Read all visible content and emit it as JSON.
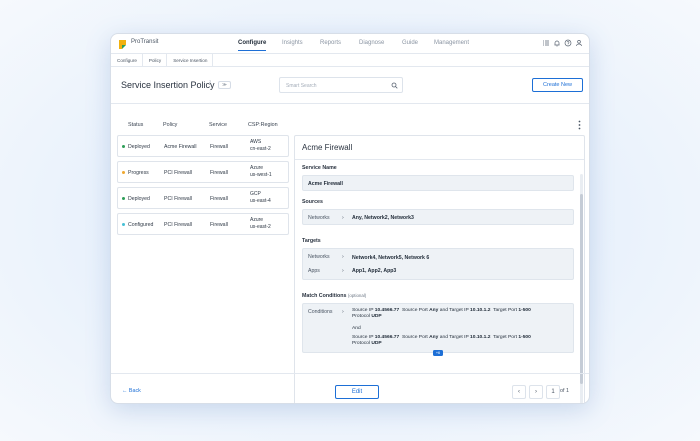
{
  "app": {
    "brand": "ProTransit"
  },
  "nav": {
    "tabs": [
      "Configure",
      "Insights",
      "Reports",
      "Diagnose",
      "Guide",
      "Management"
    ],
    "active": "Configure"
  },
  "breadcrumb": [
    "Configure",
    "Policy",
    "Service Insertion"
  ],
  "header": {
    "title": "Service Insertion Policy",
    "superscript": "2",
    "collapse": "≫",
    "search_placeholder": "Smart Search",
    "create_label": "Create New"
  },
  "table": {
    "columns": [
      "Status",
      "Policy",
      "Service",
      "CSP:Region"
    ],
    "rows": [
      {
        "status": "Deployed",
        "status_color": "#2e9e57",
        "policy": "Acme Firewall",
        "service": "Firewall",
        "csp": "AWS",
        "region": "cn-east-2"
      },
      {
        "status": "Progress",
        "status_color": "#f0a830",
        "policy": "PCI Firewall",
        "service": "Firewall",
        "csp": "Azure",
        "region": "us-west-1"
      },
      {
        "status": "Deployed",
        "status_color": "#2e9e57",
        "policy": "PCI Firewall",
        "service": "Firewall",
        "csp": "GCP",
        "region": "us-east-4"
      },
      {
        "status": "Configured",
        "status_color": "#47c0d6",
        "policy": "PCI Firewall",
        "service": "Firewall",
        "csp": "Azure",
        "region": "us-east-2"
      }
    ]
  },
  "detail": {
    "title": "Acme Firewall",
    "service_name_label": "Service Name",
    "service_name": "Acme Firewall",
    "sources_label": "Sources",
    "sources_key": "Networks",
    "sources_value": "Any, Network2, Network3",
    "targets_label": "Targets",
    "targets": [
      {
        "key": "Networks",
        "value": "Network4, Network5, Network 6"
      },
      {
        "key": "Apps",
        "value": "App1, App2, App3"
      }
    ],
    "match_label": "Match Conditions",
    "match_optional": "(optional)",
    "conditions_key": "Conditions",
    "cond": {
      "src_ip": "Source IP",
      "src_ip_v": "10.4566.77",
      "src_port": "Source Port",
      "src_port_v": "Any",
      "and_tgt": "and Target IP",
      "tgt_ip_v": "10.10.1.2",
      "tgt_port": "Target Port",
      "tgt_port_v": "1-500",
      "protocol": "Protocol",
      "protocol_v": "UDP",
      "and": "And"
    },
    "more_badge": "+6"
  },
  "arrow": "›",
  "footer": {
    "back": "← Back",
    "edit": "Edit",
    "prev": "‹",
    "next": "›",
    "page": "1",
    "of": "of 1"
  },
  "colors": {
    "accent": "#1d6fd6"
  }
}
